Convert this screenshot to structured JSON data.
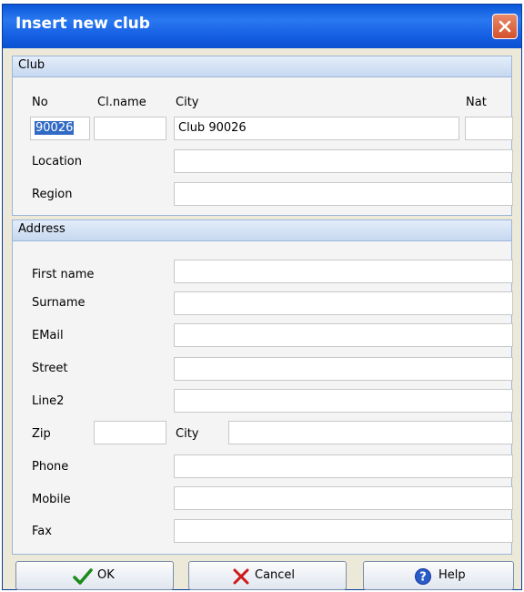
{
  "window": {
    "title": "Insert new club"
  },
  "club_section": {
    "header": "Club",
    "no_label": "No",
    "clname_label": "Cl.name",
    "city_label": "City",
    "nat_label": "Nat",
    "no_value": "90026",
    "clname_value": "",
    "city_value": "Club 90026",
    "nat_value": "",
    "location_label": "Location",
    "location_value": "",
    "region_label": "Region",
    "region_value": ""
  },
  "address_section": {
    "header": "Address",
    "first_name_label": "First name",
    "surname_label": "Surname",
    "email_label": "EMail",
    "street_label": "Street",
    "line2_label": "Line2",
    "zip_label": "Zip",
    "city_label": "City",
    "phone_label": "Phone",
    "mobile_label": "Mobile",
    "fax_label": "Fax"
  },
  "buttons": {
    "ok": "OK",
    "cancel": "Cancel",
    "help": "Help"
  },
  "icons": {
    "close": "close-icon",
    "ok": "checkmark-icon",
    "cancel": "x-icon",
    "help": "help-icon"
  },
  "colors": {
    "titlebar": "#0a58d8",
    "close": "#d4512c",
    "selection": "#316ac5",
    "ok_icon": "#1a8a1a",
    "cancel_icon": "#cc1b1b"
  }
}
